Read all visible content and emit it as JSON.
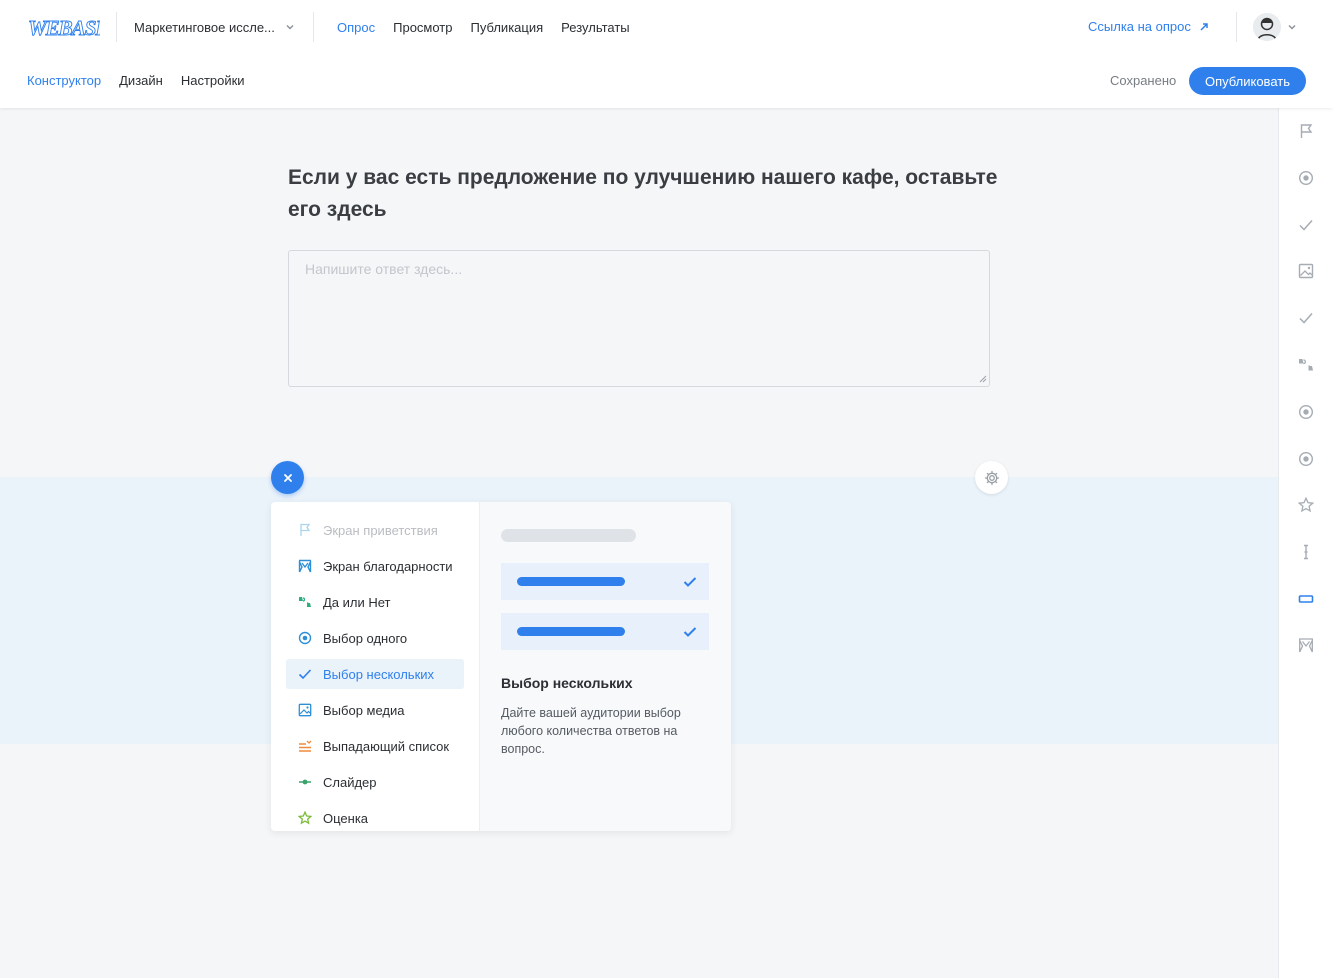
{
  "header": {
    "logo_text": "WEBASK",
    "survey_name": "Маркетинговое иссле...",
    "tabs": [
      {
        "label": "Опрос",
        "active": true
      },
      {
        "label": "Просмотр",
        "active": false
      },
      {
        "label": "Публикация",
        "active": false
      },
      {
        "label": "Результаты",
        "active": false
      }
    ],
    "survey_link": "Ссылка на опрос",
    "sub_tabs": [
      {
        "label": "Конструктор",
        "active": true
      },
      {
        "label": "Дизайн",
        "active": false
      },
      {
        "label": "Настройки",
        "active": false
      }
    ],
    "status": "Сохранено",
    "publish_label": "Опубликовать"
  },
  "question": {
    "title": "Если у вас есть предложение по улучшению нашего кафе, оставьте его здесь",
    "placeholder": "Напишите ответ здесь..."
  },
  "question_types": [
    {
      "label": "Экран приветствия",
      "icon": "flag-icon",
      "disabled": true
    },
    {
      "label": "Экран благодарности",
      "icon": "theater-icon"
    },
    {
      "label": "Да или Нет",
      "icon": "thumbs-icon"
    },
    {
      "label": "Выбор одного",
      "icon": "radio-icon"
    },
    {
      "label": "Выбор нескольких",
      "icon": "check-icon",
      "selected": true
    },
    {
      "label": "Выбор медиа",
      "icon": "image-icon"
    },
    {
      "label": "Выпадающий список",
      "icon": "list-icon"
    },
    {
      "label": "Слайдер",
      "icon": "slider-icon"
    },
    {
      "label": "Оценка",
      "icon": "star-icon"
    }
  ],
  "preview": {
    "title": "Выбор нескольких",
    "description": "Дайте вашей аудитории выбор любого количества ответов на вопрос."
  },
  "rail_icons": [
    "flag-icon",
    "radio-icon",
    "check-icon",
    "image-icon",
    "check-icon",
    "thumbs-icon",
    "radio-icon",
    "radio-icon",
    "star-icon",
    "text-cursor-icon",
    "input-icon",
    "theater-icon"
  ],
  "colors": {
    "accent": "#2f80ed",
    "band": "#eaf2fa"
  }
}
